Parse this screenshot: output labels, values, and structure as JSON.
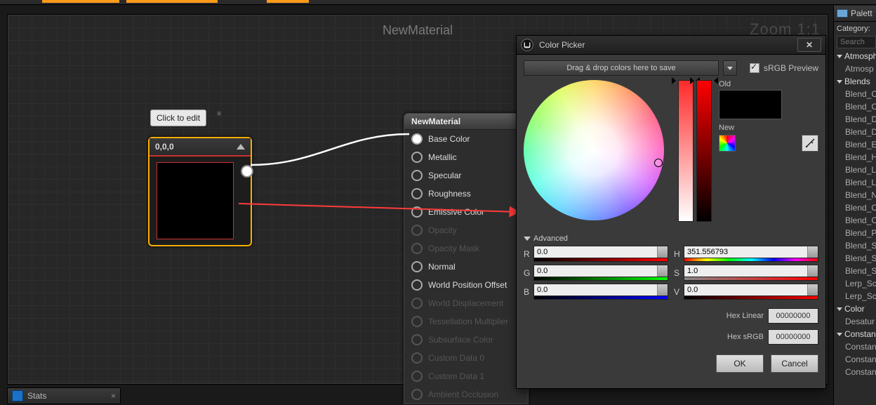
{
  "graph": {
    "title": "NewMaterial",
    "zoom": "Zoom 1:1",
    "tooltip": "Click to edit"
  },
  "const_node": {
    "header": "0,0,0"
  },
  "material_node": {
    "title": "NewMaterial",
    "inputs": [
      {
        "label": "Base Color",
        "enabled": true,
        "connected": true
      },
      {
        "label": "Metallic",
        "enabled": true,
        "connected": false
      },
      {
        "label": "Specular",
        "enabled": true,
        "connected": false
      },
      {
        "label": "Roughness",
        "enabled": true,
        "connected": false
      },
      {
        "label": "Emissive Color",
        "enabled": true,
        "connected": false
      },
      {
        "label": "Opacity",
        "enabled": false,
        "connected": false
      },
      {
        "label": "Opacity Mask",
        "enabled": false,
        "connected": false
      },
      {
        "label": "Normal",
        "enabled": true,
        "connected": false
      },
      {
        "label": "World Position Offset",
        "enabled": true,
        "connected": false
      },
      {
        "label": "World Displacement",
        "enabled": false,
        "connected": false
      },
      {
        "label": "Tessellation Multiplier",
        "enabled": false,
        "connected": false
      },
      {
        "label": "Subsurface Color",
        "enabled": false,
        "connected": false
      },
      {
        "label": "Custom Data 0",
        "enabled": false,
        "connected": false
      },
      {
        "label": "Custom Data 1",
        "enabled": false,
        "connected": false
      },
      {
        "label": "Ambient Occlusion",
        "enabled": false,
        "connected": false
      }
    ]
  },
  "picker": {
    "title": "Color Picker",
    "drop_hint": "Drag & drop colors here to save",
    "srgb_label": "sRGB Preview",
    "srgb_checked": true,
    "old_label": "Old",
    "new_label": "New",
    "advanced_label": "Advanced",
    "channels": {
      "R": "0.0",
      "G": "0.0",
      "B": "0.0",
      "H": "351.556793",
      "S": "1.0",
      "V": "0.0"
    },
    "hex_linear_label": "Hex Linear",
    "hex_linear": "00000000",
    "hex_srgb_label": "Hex sRGB",
    "hex_srgb": "00000000",
    "ok": "OK",
    "cancel": "Cancel"
  },
  "stats_tab": "Stats",
  "palette": {
    "title": "Palett",
    "category_label": "Category:",
    "search_placeholder": "Search",
    "groups": [
      {
        "name": "Atmosph",
        "items": [
          "Atmosp"
        ]
      },
      {
        "name": "Blends",
        "items": [
          "Blend_C",
          "Blend_C",
          "Blend_D",
          "Blend_D",
          "Blend_E",
          "Blend_H",
          "Blend_L",
          "Blend_L",
          "Blend_N",
          "Blend_C",
          "Blend_C",
          "Blend_P",
          "Blend_S",
          "Blend_S",
          "Blend_S",
          "Lerp_Sc",
          "Lerp_Sc"
        ]
      },
      {
        "name": "Color",
        "items": [
          "Desatur"
        ]
      },
      {
        "name": "Constan",
        "items": [
          "Constan",
          "Constan",
          "Constan"
        ]
      }
    ]
  }
}
